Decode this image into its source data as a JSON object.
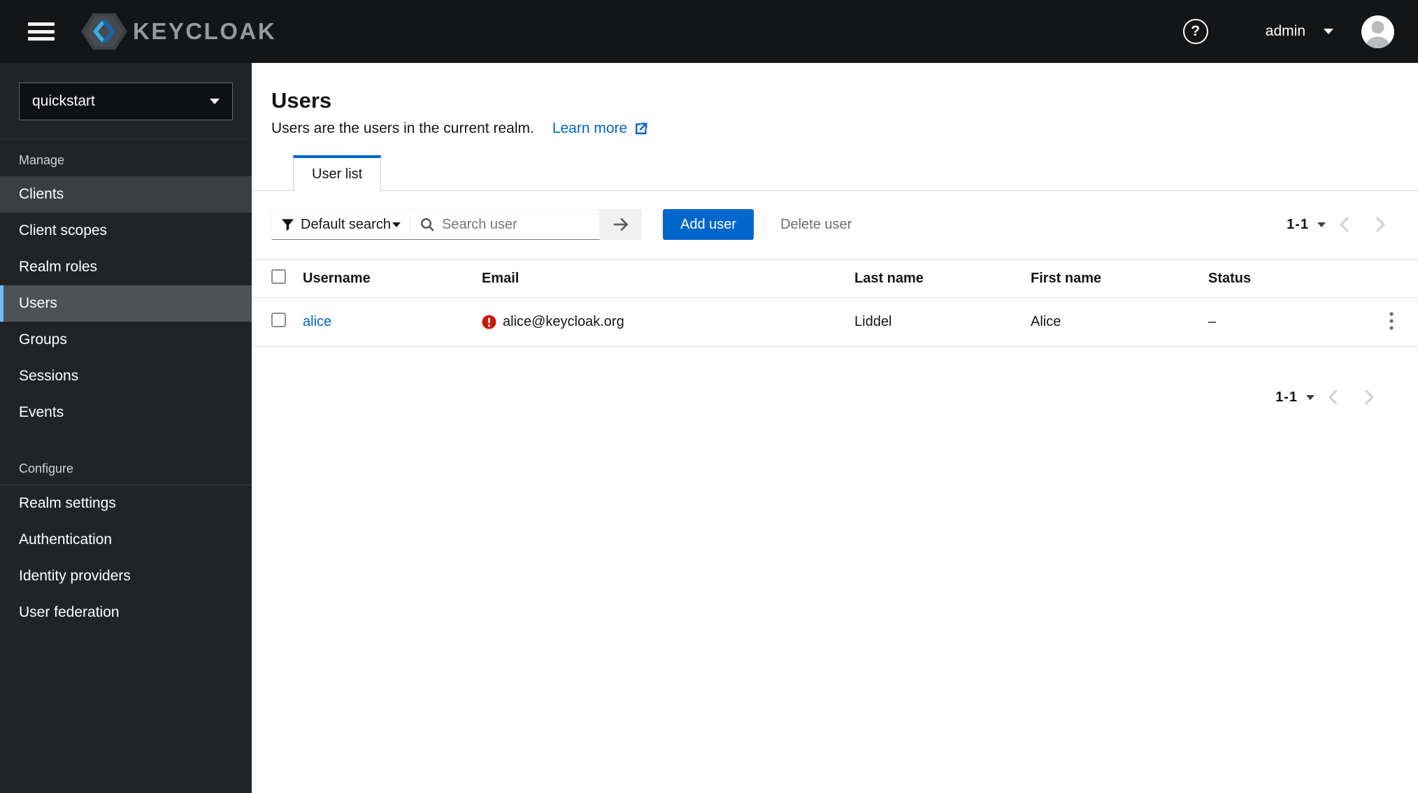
{
  "masthead": {
    "brand": "KEYCLOAK",
    "user": "admin"
  },
  "sidebar": {
    "realm": "quickstart",
    "sections": [
      {
        "label": "Manage",
        "items": [
          {
            "label": "Clients",
            "state": "hover"
          },
          {
            "label": "Client scopes",
            "state": "normal"
          },
          {
            "label": "Realm roles",
            "state": "normal"
          },
          {
            "label": "Users",
            "state": "active"
          },
          {
            "label": "Groups",
            "state": "normal"
          },
          {
            "label": "Sessions",
            "state": "normal"
          },
          {
            "label": "Events",
            "state": "normal"
          }
        ]
      },
      {
        "label": "Configure",
        "items": [
          {
            "label": "Realm settings",
            "state": "normal"
          },
          {
            "label": "Authentication",
            "state": "normal"
          },
          {
            "label": "Identity providers",
            "state": "normal"
          },
          {
            "label": "User federation",
            "state": "normal"
          }
        ]
      }
    ]
  },
  "page": {
    "title": "Users",
    "subtitle": "Users are the users in the current realm.",
    "learn_more": "Learn more",
    "tab": "User list"
  },
  "toolbar": {
    "filter": "Default search",
    "search_placeholder": "Search user",
    "add": "Add user",
    "delete": "Delete user"
  },
  "pagination": {
    "range": "1-1"
  },
  "table": {
    "columns": [
      "Username",
      "Email",
      "Last name",
      "First name",
      "Status"
    ],
    "rows": [
      {
        "username": "alice",
        "email": "alice@keycloak.org",
        "email_error": true,
        "last_name": "Liddel",
        "first_name": "Alice",
        "status": "–"
      }
    ]
  },
  "icons": {
    "menu": "hamburger",
    "help": "question-circle",
    "user_caret": "triangle-down",
    "filter": "funnel",
    "search": "magnifier",
    "go": "arrow-right",
    "learn_more": "external-link",
    "email_error": "exclamation-circle",
    "row_actions": "kebab-vertical",
    "page_prev": "chevron-left",
    "page_next": "chevron-right"
  },
  "colors": {
    "accent": "#0066cc",
    "link": "#0066cc",
    "danger": "#c9190b",
    "masthead_bg": "#141517",
    "sidebar_bg": "#212427",
    "nav_selected_bg": "#4f5255",
    "nav_selected_bar": "#73bcf7",
    "nav_hover_bg": "#3c3f42",
    "muted_text": "#6a6e73",
    "border": "#d2d2d2",
    "disabled_chevron": "#d2d2d2"
  }
}
